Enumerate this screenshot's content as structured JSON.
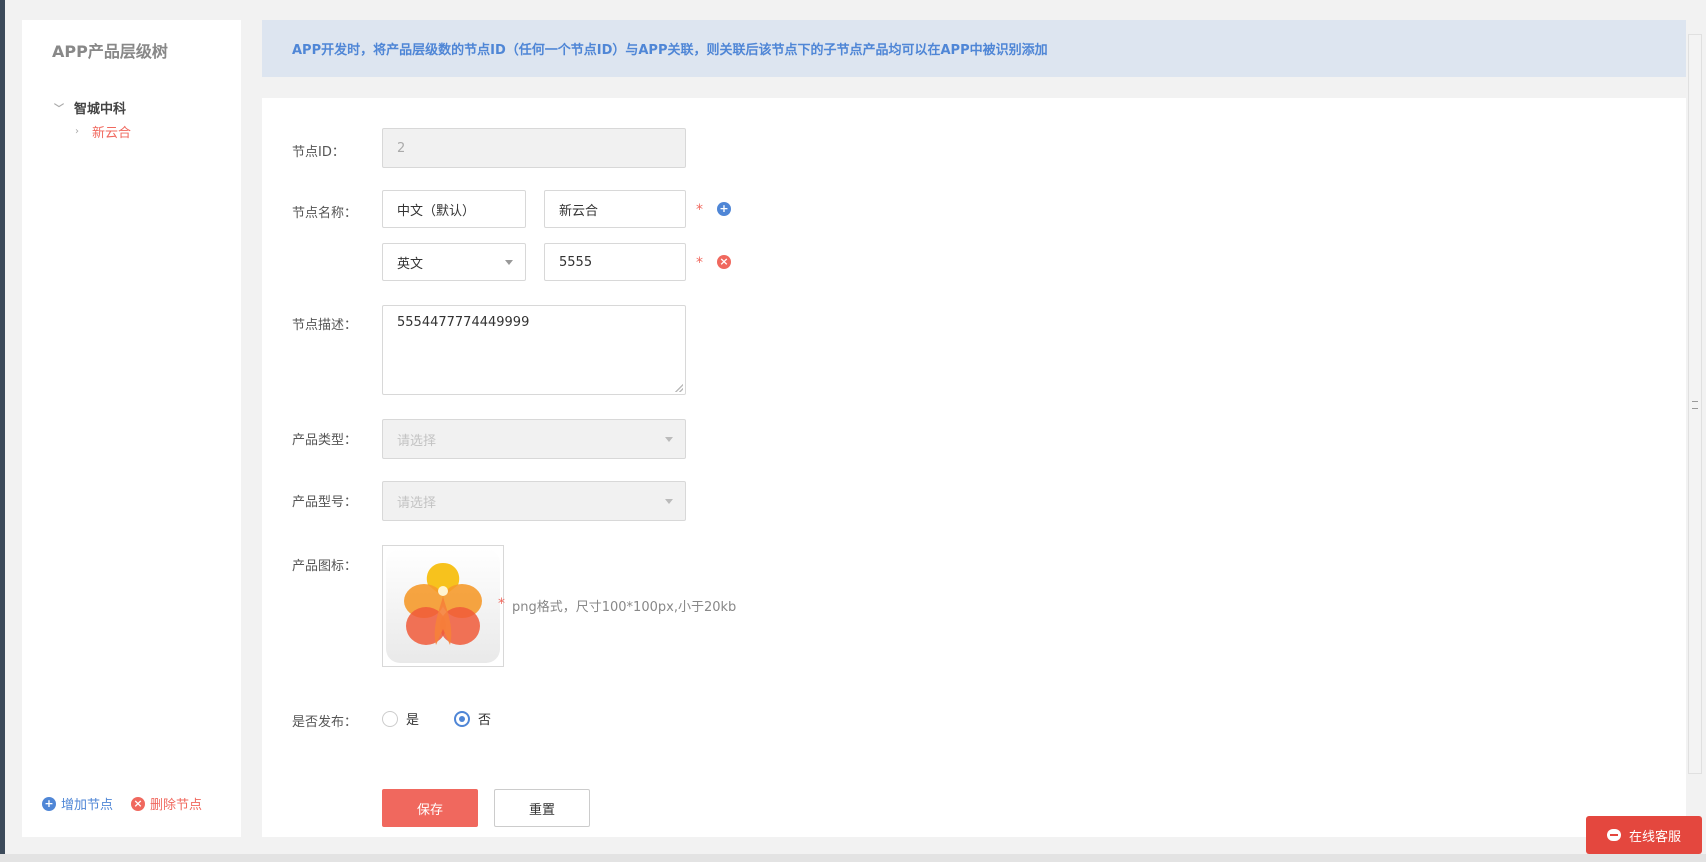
{
  "sidebar": {
    "title": "APP产品层级树",
    "tree": {
      "root_label": "智城中科",
      "child_label": "新云合"
    },
    "add_node_label": "增加节点",
    "delete_node_label": "删除节点"
  },
  "notice": "APP开发时，将产品层级数的节点ID（任何一个节点ID）与APP关联，则关联后该节点下的子节点产品均可以在APP中被识别添加",
  "form": {
    "node_id": {
      "label": "节点ID：",
      "value": "2"
    },
    "node_name": {
      "label": "节点名称：",
      "rows": [
        {
          "language": "中文（默认）",
          "value": "新云合"
        },
        {
          "language": "英文",
          "value": "5555"
        }
      ]
    },
    "node_desc": {
      "label": "节点描述：",
      "value": "5554477774449999"
    },
    "product_type": {
      "label": "产品类型：",
      "placeholder": "请选择"
    },
    "product_model": {
      "label": "产品型号：",
      "placeholder": "请选择"
    },
    "product_icon": {
      "label": "产品图标：",
      "hint": "png格式，尺寸100*100px,小于20kb"
    },
    "publish": {
      "label": "是否发布：",
      "options": [
        "是",
        "否"
      ],
      "selected": "否"
    },
    "required_mark": "*",
    "save_label": "保存",
    "reset_label": "重置"
  },
  "chat_label": "在线客服",
  "colors": {
    "accent_blue": "#4f86d6",
    "accent_red": "#f0685e",
    "notice_bg": "#dde5f0"
  }
}
